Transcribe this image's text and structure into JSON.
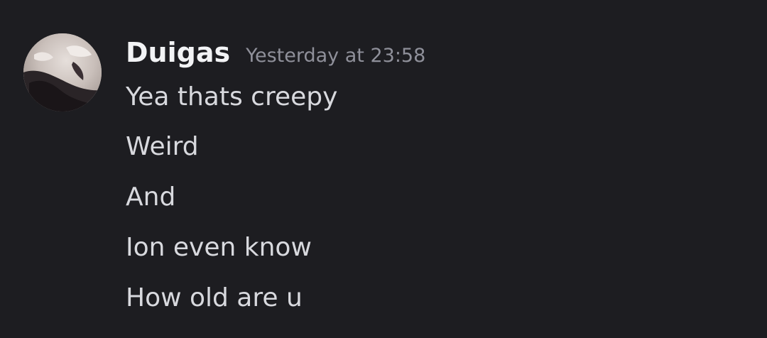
{
  "message": {
    "author": "Duigas",
    "timestamp": "Yesterday at 23:58",
    "avatar_icon": "user-avatar-photo",
    "lines": [
      "Yea thats creepy",
      "Weird",
      "And",
      "Ion even know",
      "How old are u"
    ]
  },
  "colors": {
    "background": "#1d1d21",
    "username": "#f2f3f5",
    "timestamp": "#8f909a",
    "message_text": "#d8d9de"
  }
}
